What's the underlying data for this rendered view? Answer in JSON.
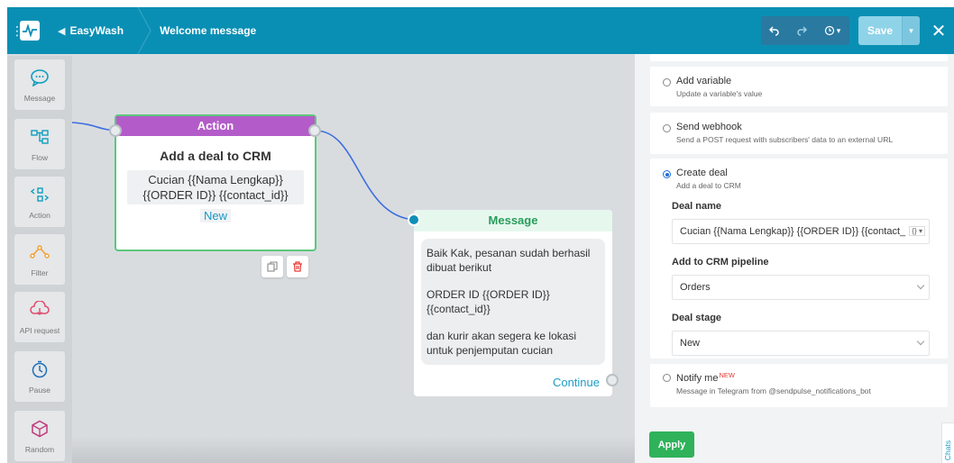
{
  "topbar": {
    "project_name": "EasyWash",
    "flow_name": "Welcome message",
    "save_label": "Save",
    "bg_color": "#0a8fb4"
  },
  "tools": [
    {
      "label": "Message",
      "icon": "message-icon"
    },
    {
      "label": "Flow",
      "icon": "flow-icon"
    },
    {
      "label": "Action",
      "icon": "action-icon"
    },
    {
      "label": "Filter",
      "icon": "filter-icon"
    },
    {
      "label": "API request",
      "icon": "api-request-icon"
    },
    {
      "label": "Pause",
      "icon": "pause-icon"
    },
    {
      "label": "Random",
      "icon": "random-icon"
    }
  ],
  "action_node": {
    "header": "Action",
    "title": "Add a deal to CRM",
    "deal_name": "Cucian {{Nama Lengkap}} {{ORDER ID}} {{contact_id}}",
    "stage": "New",
    "header_color": "#b35cc9"
  },
  "message_node": {
    "header": "Message",
    "paragraphs": [
      "Baik Kak, pesanan sudah berhasil dibuat berikut",
      "ORDER ID {{ORDER ID}} {{contact_id}}",
      "dan kurir akan segera ke lokasi untuk penjemputan cucian"
    ],
    "footer": "Continue"
  },
  "panel": {
    "options": [
      {
        "title": "Add variable",
        "subtitle": "Update a variable's value"
      },
      {
        "title": "Send webhook",
        "subtitle": "Send a POST request with subscribers' data to an external URL"
      },
      {
        "title": "Create deal",
        "subtitle": "Add a deal to CRM"
      },
      {
        "title": "Notify me",
        "badge": "NEW",
        "subtitle": "Message in Telegram from @sendpulse_notifications_bot"
      }
    ],
    "deal_name_label": "Deal name",
    "deal_name_value": "Cucian {{Nama Lengkap}} {{ORDER ID}} {{contact_",
    "pipeline_label": "Add to CRM pipeline",
    "pipeline_value": "Orders",
    "stage_label": "Deal stage",
    "stage_value": "New",
    "apply_label": "Apply",
    "chats_tab": "Chats"
  }
}
